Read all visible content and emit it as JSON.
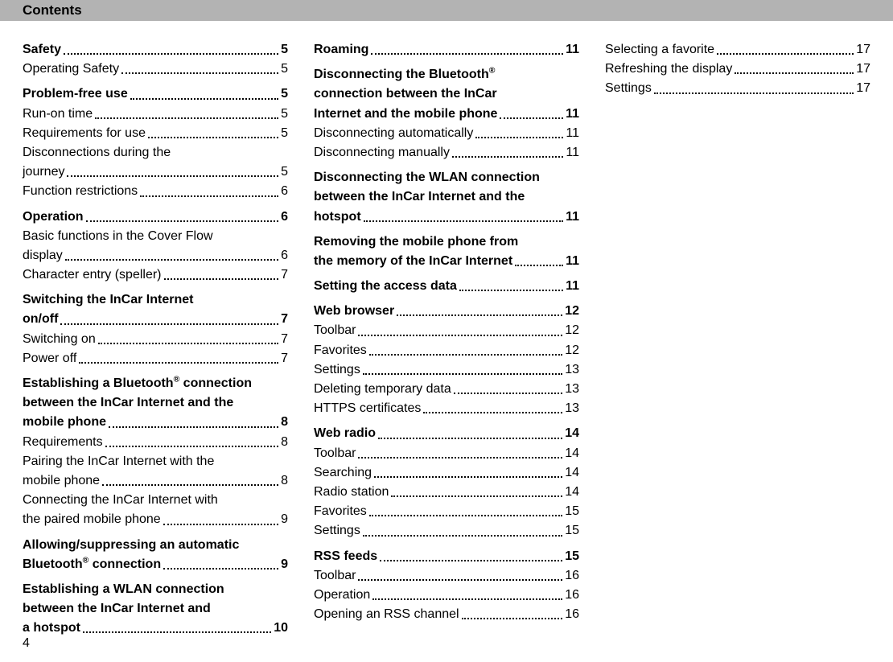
{
  "header": {
    "title": "Contents"
  },
  "page_number": "4",
  "col1": [
    {
      "type": "entry",
      "bold": true,
      "label": "Safety",
      "page": "5"
    },
    {
      "type": "entry",
      "label": "Operating Safety",
      "page": "5"
    },
    {
      "type": "spacer"
    },
    {
      "type": "entry",
      "bold": true,
      "label": "Problem-free use",
      "page": "5"
    },
    {
      "type": "entry",
      "label": "Run-on time",
      "page": "5"
    },
    {
      "type": "entry",
      "label": "Requirements for use",
      "page": "5"
    },
    {
      "type": "cont",
      "label": "Disconnections during the"
    },
    {
      "type": "entry",
      "label": "journey",
      "page": "5"
    },
    {
      "type": "entry",
      "label": "Function restrictions",
      "page": "6"
    },
    {
      "type": "spacer"
    },
    {
      "type": "entry",
      "bold": true,
      "label": "Operation",
      "page": "6"
    },
    {
      "type": "cont",
      "label": "Basic functions in the Cover Flow"
    },
    {
      "type": "entry",
      "label": "display",
      "page": "6"
    },
    {
      "type": "entry",
      "label": "Character entry (speller)",
      "page": "7"
    },
    {
      "type": "spacer"
    },
    {
      "type": "cont",
      "bold": true,
      "label": "Switching the InCar Internet"
    },
    {
      "type": "entry",
      "bold": true,
      "label": "on/off",
      "page": "7"
    },
    {
      "type": "entry",
      "label": "Switching on",
      "page": "7"
    },
    {
      "type": "entry",
      "label": "Power off",
      "page": "7"
    },
    {
      "type": "spacer"
    },
    {
      "type": "cont",
      "bold": true,
      "labelHtml": "Establishing a Bluetooth<sup>®</sup> connection"
    },
    {
      "type": "cont",
      "bold": true,
      "label": "between the InCar Internet and the"
    },
    {
      "type": "entry",
      "bold": true,
      "label": "mobile phone",
      "page": "8"
    },
    {
      "type": "entry",
      "label": "Requirements",
      "page": "8"
    },
    {
      "type": "cont",
      "label": "Pairing the InCar Internet with the"
    },
    {
      "type": "entry",
      "label": "mobile phone",
      "page": "8"
    },
    {
      "type": "cont",
      "label": "Connecting the InCar Internet with"
    },
    {
      "type": "entry",
      "label": "the paired mobile phone",
      "page": "9"
    },
    {
      "type": "spacer"
    },
    {
      "type": "cont",
      "bold": true,
      "label": "Allowing/suppressing an automatic"
    },
    {
      "type": "entry",
      "bold": true,
      "labelHtml": "Bluetooth<sup>®</sup> connection",
      "page": "9"
    },
    {
      "type": "spacer"
    },
    {
      "type": "cont",
      "bold": true,
      "label": "Establishing a WLAN connection"
    },
    {
      "type": "cont",
      "bold": true,
      "label": "between the InCar Internet and"
    },
    {
      "type": "entry",
      "bold": true,
      "label": "a hotspot",
      "page": "10"
    }
  ],
  "col2": [
    {
      "type": "entry",
      "bold": true,
      "label": "Roaming",
      "page": "11"
    },
    {
      "type": "spacer"
    },
    {
      "type": "cont",
      "bold": true,
      "labelHtml": "Disconnecting the Bluetooth<sup>®</sup>"
    },
    {
      "type": "cont",
      "bold": true,
      "label": "connection between the InCar"
    },
    {
      "type": "entry",
      "bold": true,
      "label": "Internet and the mobile phone",
      "page": "11"
    },
    {
      "type": "entry",
      "label": "Disconnecting automatically",
      "page": "11"
    },
    {
      "type": "entry",
      "label": "Disconnecting manually",
      "page": "11"
    },
    {
      "type": "spacer"
    },
    {
      "type": "cont",
      "bold": true,
      "label": "Disconnecting the WLAN connection"
    },
    {
      "type": "cont",
      "bold": true,
      "label": "between the InCar Internet and the"
    },
    {
      "type": "entry",
      "bold": true,
      "label": "hotspot",
      "page": "11"
    },
    {
      "type": "spacer"
    },
    {
      "type": "cont",
      "bold": true,
      "label": "Removing the mobile phone from"
    },
    {
      "type": "entry",
      "bold": true,
      "label": "the memory of the InCar Internet",
      "page": "11"
    },
    {
      "type": "spacer"
    },
    {
      "type": "entry",
      "bold": true,
      "label": "Setting the access data",
      "page": "11"
    },
    {
      "type": "spacer"
    },
    {
      "type": "entry",
      "bold": true,
      "label": "Web browser",
      "page": "12"
    },
    {
      "type": "entry",
      "label": "Toolbar",
      "page": "12"
    },
    {
      "type": "entry",
      "label": "Favorites",
      "page": "12"
    },
    {
      "type": "entry",
      "label": "Settings",
      "page": "13"
    },
    {
      "type": "entry",
      "label": "Deleting temporary data",
      "page": "13"
    },
    {
      "type": "entry",
      "label": "HTTPS certificates",
      "page": "13"
    },
    {
      "type": "spacer"
    },
    {
      "type": "entry",
      "bold": true,
      "label": "Web radio",
      "page": "14"
    },
    {
      "type": "entry",
      "label": "Toolbar",
      "page": "14"
    },
    {
      "type": "entry",
      "label": "Searching",
      "page": "14"
    },
    {
      "type": "entry",
      "label": "Radio station",
      "page": "14"
    },
    {
      "type": "entry",
      "label": "Favorites",
      "page": "15"
    },
    {
      "type": "entry",
      "label": "Settings",
      "page": "15"
    },
    {
      "type": "spacer"
    },
    {
      "type": "entry",
      "bold": true,
      "label": "RSS feeds",
      "page": "15"
    },
    {
      "type": "entry",
      "label": "Toolbar",
      "page": "16"
    },
    {
      "type": "entry",
      "label": "Operation",
      "page": "16"
    },
    {
      "type": "entry",
      "label": "Opening an RSS channel",
      "page": "16"
    }
  ],
  "col3": [
    {
      "type": "entry",
      "label": "Selecting a favorite",
      "page": "17"
    },
    {
      "type": "entry",
      "label": "Refreshing the display",
      "page": "17"
    },
    {
      "type": "entry",
      "label": "Settings",
      "page": "17"
    }
  ]
}
